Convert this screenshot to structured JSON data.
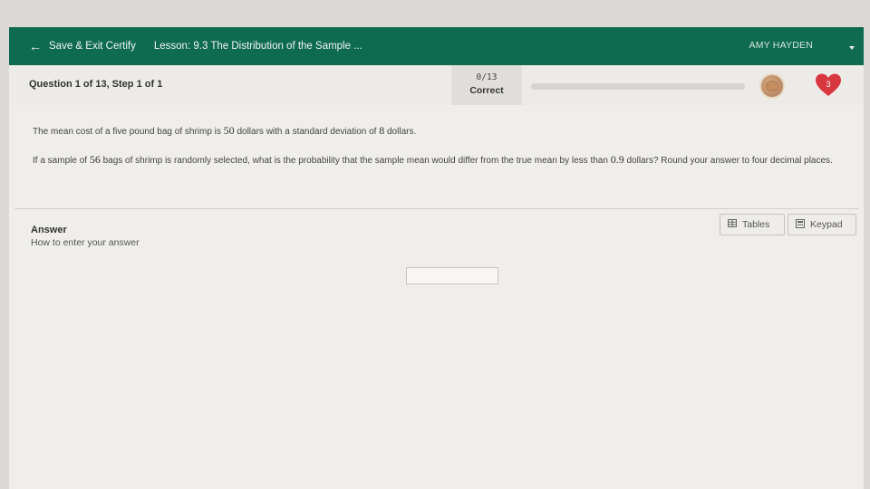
{
  "header": {
    "back_label": "Save & Exit Certify",
    "lesson": "Lesson: 9.3 The Distribution of the Sample ...",
    "user": "AMY HAYDEN"
  },
  "question_bar": {
    "label": "Question 1 of 13, Step 1 of 1",
    "score_count": "0/13",
    "score_status": "Correct",
    "progress_fraction": 0,
    "lives": "3"
  },
  "problem": {
    "line1_prefix": "The mean cost of a five pound bag of shrimp is",
    "mean": "50",
    "line1_mid": "dollars with a standard deviation of",
    "sd": "8",
    "line1_suffix": "dollars.",
    "line2_prefix": "If a sample of",
    "n": "56",
    "line2_mid": "bags of shrimp is randomly selected, what is the probability that the sample mean would differ from the true mean by less than",
    "diff": "0.9",
    "line2_suffix": "dollars? Round your answer to four decimal places."
  },
  "answer": {
    "heading": "Answer",
    "howto": "How to enter your answer",
    "input_value": "",
    "tables_label": "Tables",
    "keypad_label": "Keypad"
  },
  "colors": {
    "header_green": "#0f6b4f",
    "heart_red": "#d9373f"
  }
}
